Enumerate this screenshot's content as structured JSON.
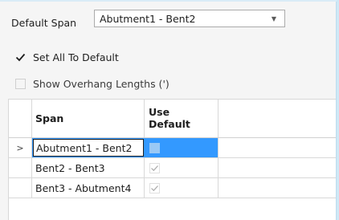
{
  "default_span": {
    "label": "Default Span",
    "selected_value": "Abutment1 - Bent2"
  },
  "options": {
    "set_all_to_default": {
      "label": "Set All To Default",
      "checked": true
    },
    "show_overhang_lengths": {
      "label": "Show Overhang Lengths (')",
      "checked": false
    }
  },
  "grid": {
    "columns": {
      "span": "Span",
      "use_default_line1": "Use",
      "use_default_line2": "Default"
    },
    "rows": [
      {
        "indicator": ">",
        "span": "Abutment1 - Bent2",
        "use_default": false,
        "selected": true
      },
      {
        "indicator": "",
        "span": "Bent2 - Bent3",
        "use_default": true,
        "selected": false
      },
      {
        "indicator": "",
        "span": "Bent3 - Abutment4",
        "use_default": true,
        "selected": false
      }
    ]
  },
  "colors": {
    "selection": "#3399ff",
    "panel_background": "#f5f5f5",
    "accent_strip": "#cfe8f6"
  }
}
